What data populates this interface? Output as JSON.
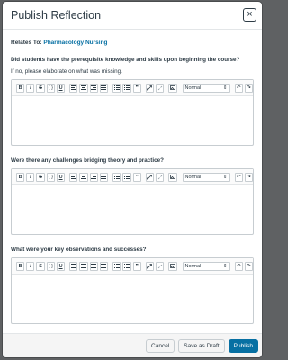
{
  "dialog": {
    "title": "Publish Reflection",
    "close_label": "×"
  },
  "relates": {
    "label": "Relates To:",
    "link": "Pharmacology Nursing"
  },
  "questions": [
    {
      "text": "Did students have the prerequisite knowledge and skills upon beginning the course?",
      "hint": "If no, please elaborate on what was missing."
    },
    {
      "text": "Were there any challenges bridging theory and practice?"
    },
    {
      "text": "What were your key observations and successes?"
    }
  ],
  "toolbar": {
    "bold": "B",
    "italic": "I",
    "strike": "S",
    "code": "{ }",
    "underline": "U",
    "quote": "❞",
    "format_value": "Normal",
    "format_options": [
      "Normal"
    ]
  },
  "footer": {
    "cancel": "Cancel",
    "draft": "Save as Draft",
    "publish": "Publish"
  },
  "colors": {
    "primary": "#0770a3",
    "text": "#2d3b45",
    "border": "#c7cdd1"
  },
  "icons": [
    "bold-icon",
    "italic-icon",
    "strikethrough-icon",
    "code-icon",
    "underline-icon",
    "align-left-icon",
    "align-center-icon",
    "align-right-icon",
    "align-justify-icon",
    "bulleted-list-icon",
    "numbered-list-icon",
    "quote-icon",
    "link-icon",
    "unlink-icon",
    "image-icon",
    "undo-icon",
    "redo-icon"
  ]
}
